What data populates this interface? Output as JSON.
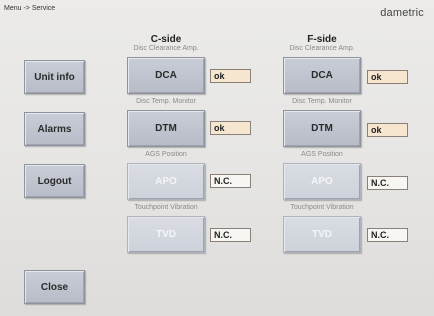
{
  "header": {
    "breadcrumb": "Menu -> Service",
    "brand": "dametric"
  },
  "sidebar": {
    "unit_info": "Unit info",
    "alarms": "Alarms",
    "logout": "Logout",
    "close": "Close"
  },
  "c_side": {
    "title": "C-side",
    "rows": [
      {
        "caption": "Disc Clearance Amp.",
        "button": "DCA",
        "status": "ok",
        "enabled": true
      },
      {
        "caption": "Disc Temp. Monitor",
        "button": "DTM",
        "status": "ok",
        "enabled": true
      },
      {
        "caption": "AGS Position",
        "button": "APO",
        "status": "N.C.",
        "enabled": false
      },
      {
        "caption": "Touchpoint Vibration",
        "button": "TVD",
        "status": "N.C.",
        "enabled": false
      }
    ]
  },
  "f_side": {
    "title": "F-side",
    "rows": [
      {
        "caption": "Disc Clearance Amp.",
        "button": "DCA",
        "status": "ok",
        "enabled": true
      },
      {
        "caption": "Disc Temp. Monitor",
        "button": "DTM",
        "status": "ok",
        "enabled": true
      },
      {
        "caption": "AGS Position",
        "button": "APO",
        "status": "N.C.",
        "enabled": false
      },
      {
        "caption": "Touchpoint Vibration",
        "button": "TVD",
        "status": "N.C.",
        "enabled": false
      }
    ]
  },
  "colors": {
    "button_face": "#bfc3cd",
    "status_ok_bg": "#f7e6cf",
    "status_nc_bg": "#f8f6f2"
  }
}
